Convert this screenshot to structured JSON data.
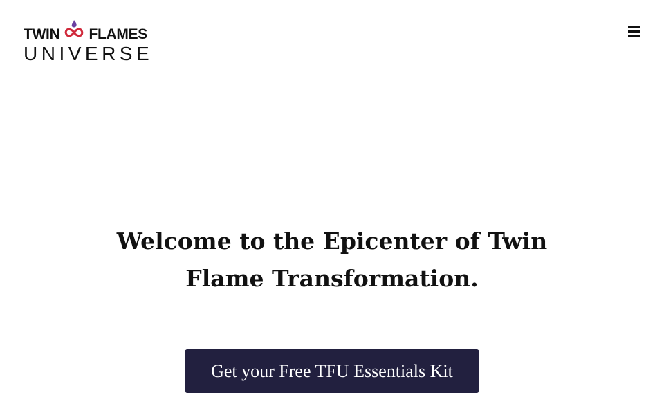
{
  "header": {
    "logo": {
      "line1_left": "TWIN",
      "line1_right": "FLAMES",
      "line2": "UNIVERSE",
      "icon": "flame-infinity-icon",
      "flame_color": "#6b3fa0",
      "infinity_color": "#d0293b"
    },
    "menu_icon": "hamburger-menu-icon"
  },
  "hero": {
    "title": "Welcome to the Epicenter of Twin Flame Transformation.",
    "cta_label": "Get your Free TFU Essentials Kit"
  },
  "colors": {
    "cta_background": "#22203f",
    "text": "#111111",
    "background": "#ffffff"
  }
}
